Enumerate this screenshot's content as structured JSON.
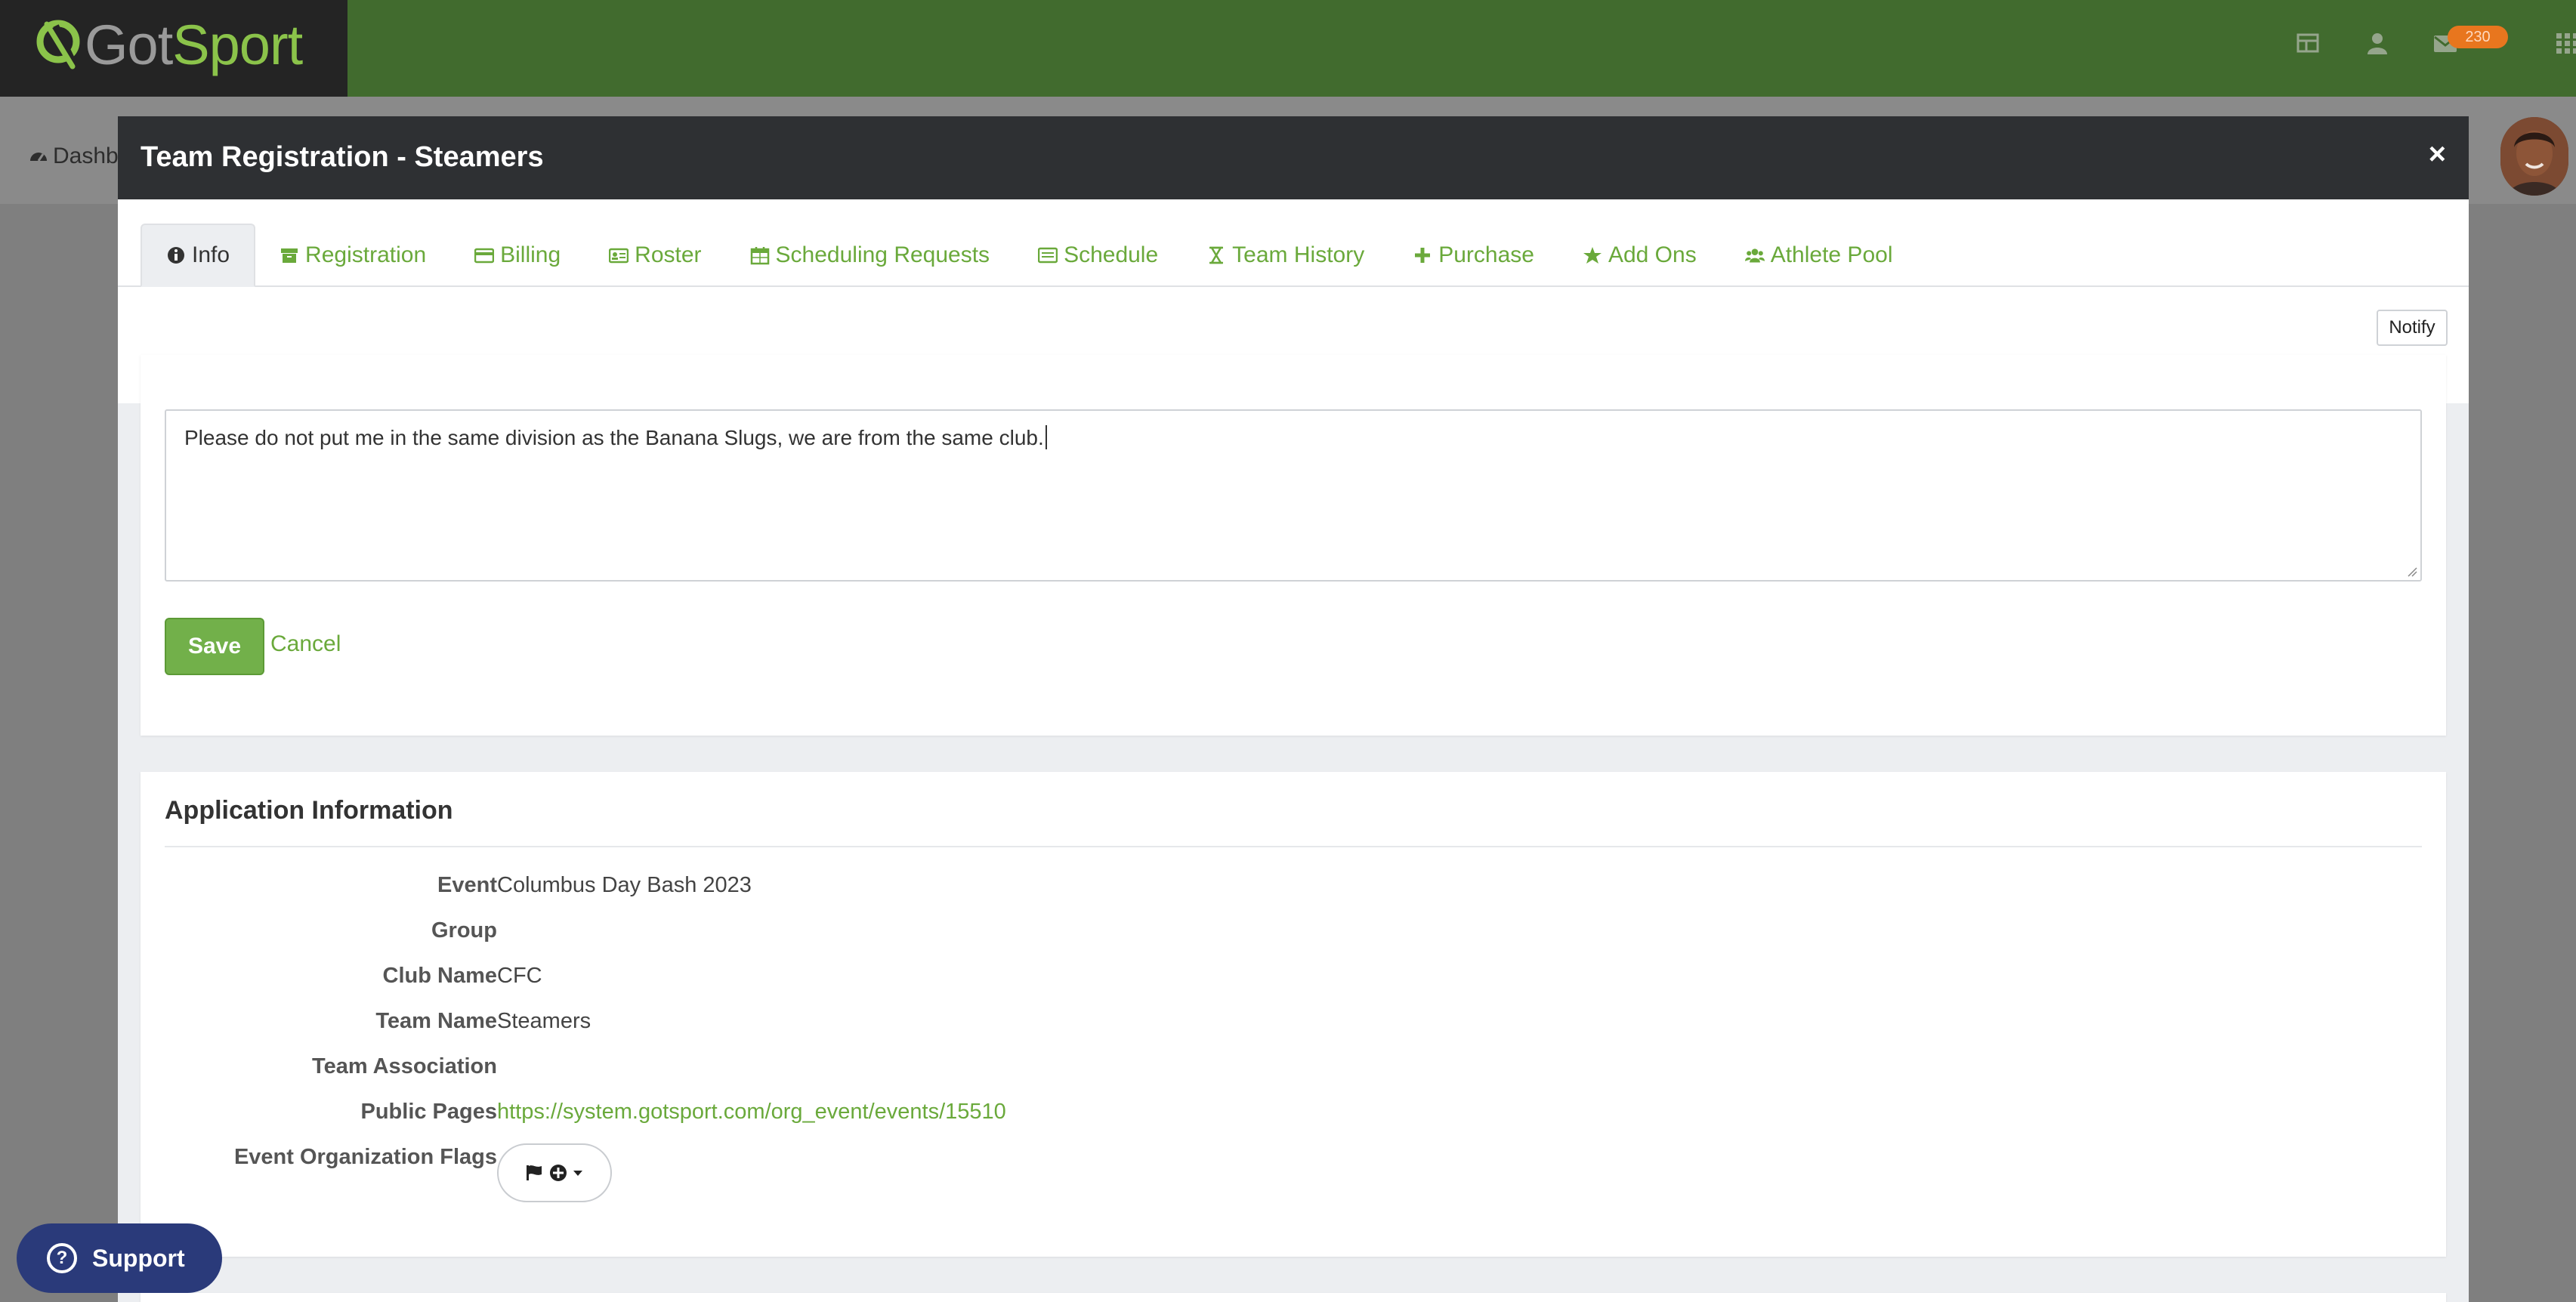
{
  "brand": {
    "logo_got": "Got",
    "logo_sport": "Sport"
  },
  "topbar": {
    "message_count": "230",
    "icons": [
      "grid-icon",
      "user-icon",
      "mail-icon",
      "apps-icon"
    ]
  },
  "subbar": {
    "dashboard_label": "Dashb"
  },
  "modal": {
    "title": "Team Registration - Steamers",
    "close": "×",
    "tabs": [
      {
        "label": "Info",
        "icon": "info-icon",
        "active": true
      },
      {
        "label": "Registration",
        "icon": "archive-icon"
      },
      {
        "label": "Billing",
        "icon": "credit-card-icon"
      },
      {
        "label": "Roster",
        "icon": "id-card-icon"
      },
      {
        "label": "Scheduling Requests",
        "icon": "calendar-icon"
      },
      {
        "label": "Schedule",
        "icon": "list-icon"
      },
      {
        "label": "Team History",
        "icon": "hourglass-icon"
      },
      {
        "label": "Purchase",
        "icon": "plus-icon"
      },
      {
        "label": "Add Ons",
        "icon": "star-icon"
      },
      {
        "label": "Athlete Pool",
        "icon": "users-icon"
      }
    ],
    "notify_label": "Notify",
    "note": {
      "value": "Please do not put me in the same division as the Banana Slugs, we are from the same club.",
      "save_label": "Save",
      "cancel_label": "Cancel"
    },
    "application": {
      "title": "Application Information",
      "fields": [
        {
          "label": "Event",
          "value": "Columbus Day Bash 2023"
        },
        {
          "label": "Group",
          "value": ""
        },
        {
          "label": "Club Name",
          "value": "CFC"
        },
        {
          "label": "Team Name",
          "value": "Steamers"
        },
        {
          "label": "Team Association",
          "value": ""
        },
        {
          "label": "Public Pages",
          "value": "https://system.gotsport.com/org_event/events/15510",
          "link": true
        },
        {
          "label": "Event Organization Flags",
          "value": ""
        }
      ]
    }
  },
  "support": {
    "label": "Support"
  },
  "colors": {
    "brand_green": "#6aa93b",
    "topbar": "#416b2e",
    "modal_header": "#2e3033",
    "support": "#2a3a7a"
  }
}
